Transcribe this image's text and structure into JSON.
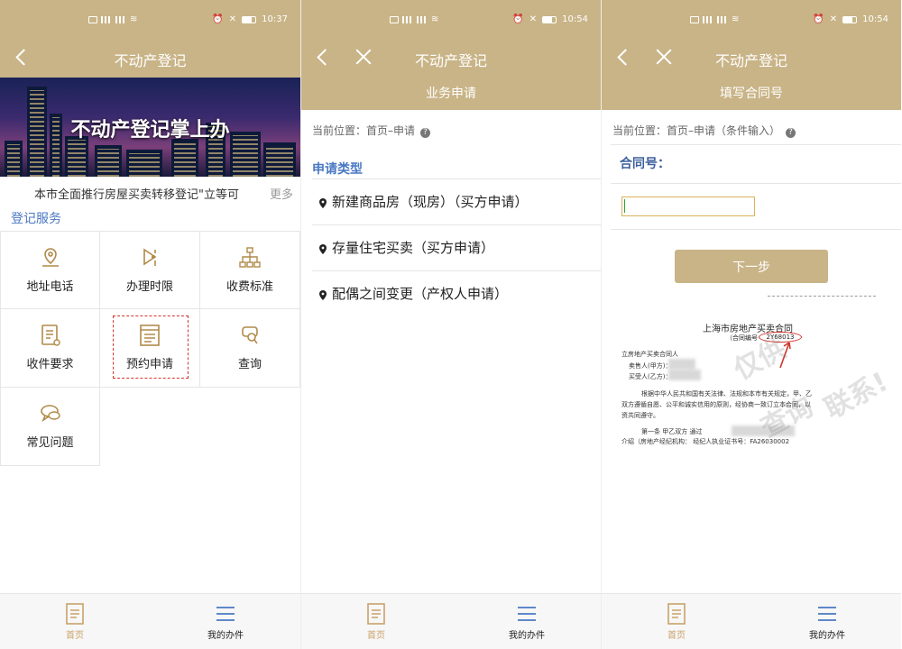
{
  "status_bars": [
    {
      "time": "10:37"
    },
    {
      "time": "10:54"
    },
    {
      "time": "10:54"
    }
  ],
  "screen1": {
    "nav_title": "不动产登记",
    "banner_title": "不动产登记掌上办",
    "notice_text": "本市全面推行房屋买卖转移登记\"立等可",
    "notice_more": "更多",
    "section_title": "登记服务",
    "grid": [
      {
        "label": "地址电话",
        "icon": "location-icon"
      },
      {
        "label": "办理时限",
        "icon": "hourglass-icon"
      },
      {
        "label": "收费标准",
        "icon": "org-chart-icon"
      },
      {
        "label": "收件要求",
        "icon": "document-icon"
      },
      {
        "label": "预约申请",
        "icon": "form-icon"
      },
      {
        "label": "查询",
        "icon": "search-icon"
      },
      {
        "label": "常见问题",
        "icon": "chat-icon"
      }
    ]
  },
  "screen2": {
    "nav_title": "不动产登记",
    "sub_header": "业务申请",
    "breadcrumb": "当前位置：首页–申请",
    "apply_title": "申请类型",
    "items": [
      "新建商品房（现房）（买方申请）",
      "存量住宅买卖（买方申请）",
      "配偶之间变更（产权人申请）"
    ]
  },
  "screen3": {
    "nav_title": "不动产登记",
    "sub_header": "填写合同号",
    "breadcrumb": "当前位置：首页–申请（条件输入）",
    "contract_label": "合同号：",
    "contract_value": "",
    "next_button": "下一步",
    "doc": {
      "title": "上海市房地产买卖合同",
      "sub": "（合同编号",
      "number": "2Y68013",
      "lines": [
        "立房地产买卖合同人",
        "卖售人(甲方)：",
        "买受人(乙方)：",
        "根据中华人民共和国有关法律、法规和本市有关规定，甲、乙",
        "双方遵循自愿、公平和诚实信用的原则，经协商一致订立本合同，以",
        "资共同遵守。",
        "第一条    甲乙双方    通过",
        "介绍（房地产经纪机构：          经纪人执业证书号：FA26030002"
      ],
      "watermark_1": "仅供",
      "watermark_2": "查询",
      "watermark_3": "联系!"
    }
  },
  "tab_bar": {
    "home": "首页",
    "mine": "我的办件"
  },
  "colors": {
    "header": "#c9b487",
    "accent_blue": "#4a78c2",
    "highlight_red": "#d0342c"
  }
}
